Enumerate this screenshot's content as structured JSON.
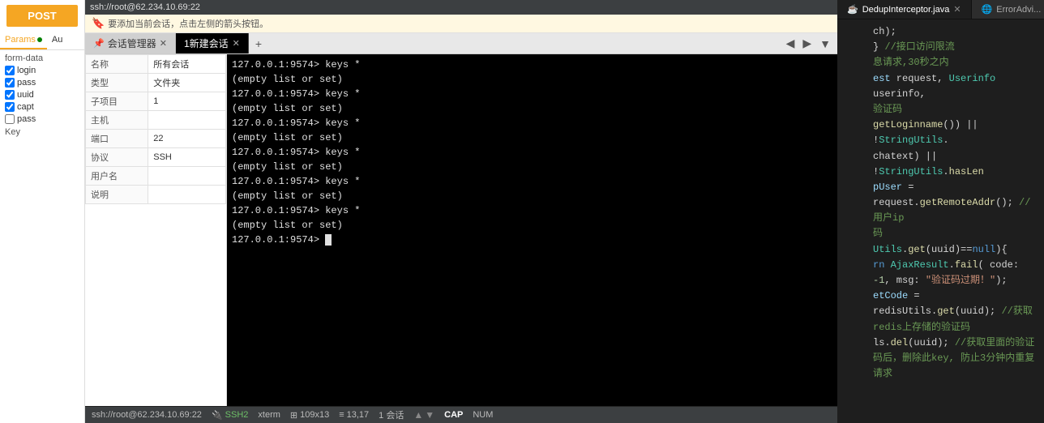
{
  "left": {
    "post_label": "POST",
    "tabs": [
      {
        "label": "Params",
        "dot": true
      },
      {
        "label": "Au"
      }
    ],
    "form_label": "form-data",
    "key_label": "Key",
    "fields": [
      {
        "checked": true,
        "name": "login"
      },
      {
        "checked": true,
        "name": "pass"
      },
      {
        "checked": true,
        "name": "uuid"
      },
      {
        "checked": true,
        "name": "capt"
      },
      {
        "checked": false,
        "name": "pass"
      }
    ],
    "key_bottom": "Key"
  },
  "ssh_panel": {
    "top_title": "ssh://root@62.234.10.69:22",
    "notice": "要添加当前会话，点击左侧的箭头按钮。",
    "session_manager_label": "会话管理器",
    "new_session_tab": "1新建会话",
    "add_tab_label": "+",
    "session_fields": [
      {
        "label": "名称",
        "value": "所有会话"
      },
      {
        "label": "类型",
        "value": "文件夹"
      },
      {
        "label": "子项目",
        "value": "1"
      },
      {
        "label": "主机",
        "value": ""
      },
      {
        "label": "端口",
        "value": "22"
      },
      {
        "label": "协议",
        "value": "SSH"
      },
      {
        "label": "用户名",
        "value": ""
      },
      {
        "label": "说明",
        "value": ""
      }
    ],
    "terminal_lines": [
      "127.0.0.1:9574> keys *",
      "(empty list or set)",
      "127.0.0.1:9574> keys *",
      "(empty list or set)",
      "127.0.0.1:9574> keys *",
      "(empty list or set)",
      "127.0.0.1:9574> keys *",
      "(empty list or set)",
      "127.0.0.1:9574> keys *",
      "(empty list or set)",
      "127.0.0.1:9574> keys *",
      "(empty list or set)",
      "127.0.0.1:9574> "
    ],
    "status_bar": {
      "connection": "ssh://root@62.234.10.69:22",
      "ssh_label": "SSH2",
      "term_label": "xterm",
      "size_label": "109x13",
      "position_label": "13,17",
      "session_label": "1 会话",
      "cap_label": "CAP",
      "num_label": "NUM"
    }
  },
  "editor": {
    "tabs": [
      {
        "label": "DedupInterceptor.java",
        "type": "java",
        "active": true
      },
      {
        "label": "ErrorAdvi...",
        "type": "globe",
        "active": false
      }
    ],
    "lines": [
      {
        "no": "",
        "code": "ch);"
      },
      {
        "no": "",
        "code": ""
      },
      {
        "no": "",
        "code": "} //接口访问限流"
      },
      {
        "no": "",
        "code": "息请求,30秒之内"
      },
      {
        "no": "",
        "code": ""
      },
      {
        "no": "",
        "code": "est request, Userinfo userinfo,"
      },
      {
        "no": "",
        "code": ""
      },
      {
        "no": "",
        "code": "验证码"
      },
      {
        "no": "",
        "code": "getLoginname()) || !StringUtils."
      },
      {
        "no": "",
        "code": "chatext) || !StringUtils.hasLen"
      },
      {
        "no": "",
        "code": ""
      },
      {
        "no": "",
        "code": "pUser = request.getRemoteAddr(); //用户ip"
      },
      {
        "no": "",
        "code": "码"
      },
      {
        "no": "",
        "code": "Utils.get(uuid)==null){"
      },
      {
        "no": "",
        "code": "rn AjaxResult.fail( code: -1, msg: \"验证码过期！\");"
      },
      {
        "no": "",
        "code": ""
      },
      {
        "no": "",
        "code": "etCode = redisUtils.get(uuid); //获取redis上存储的验证码"
      },
      {
        "no": "",
        "code": "ls.del(uuid); //获取里面的验证码后，删除此key, 防止3分钟内重复请求"
      }
    ]
  }
}
